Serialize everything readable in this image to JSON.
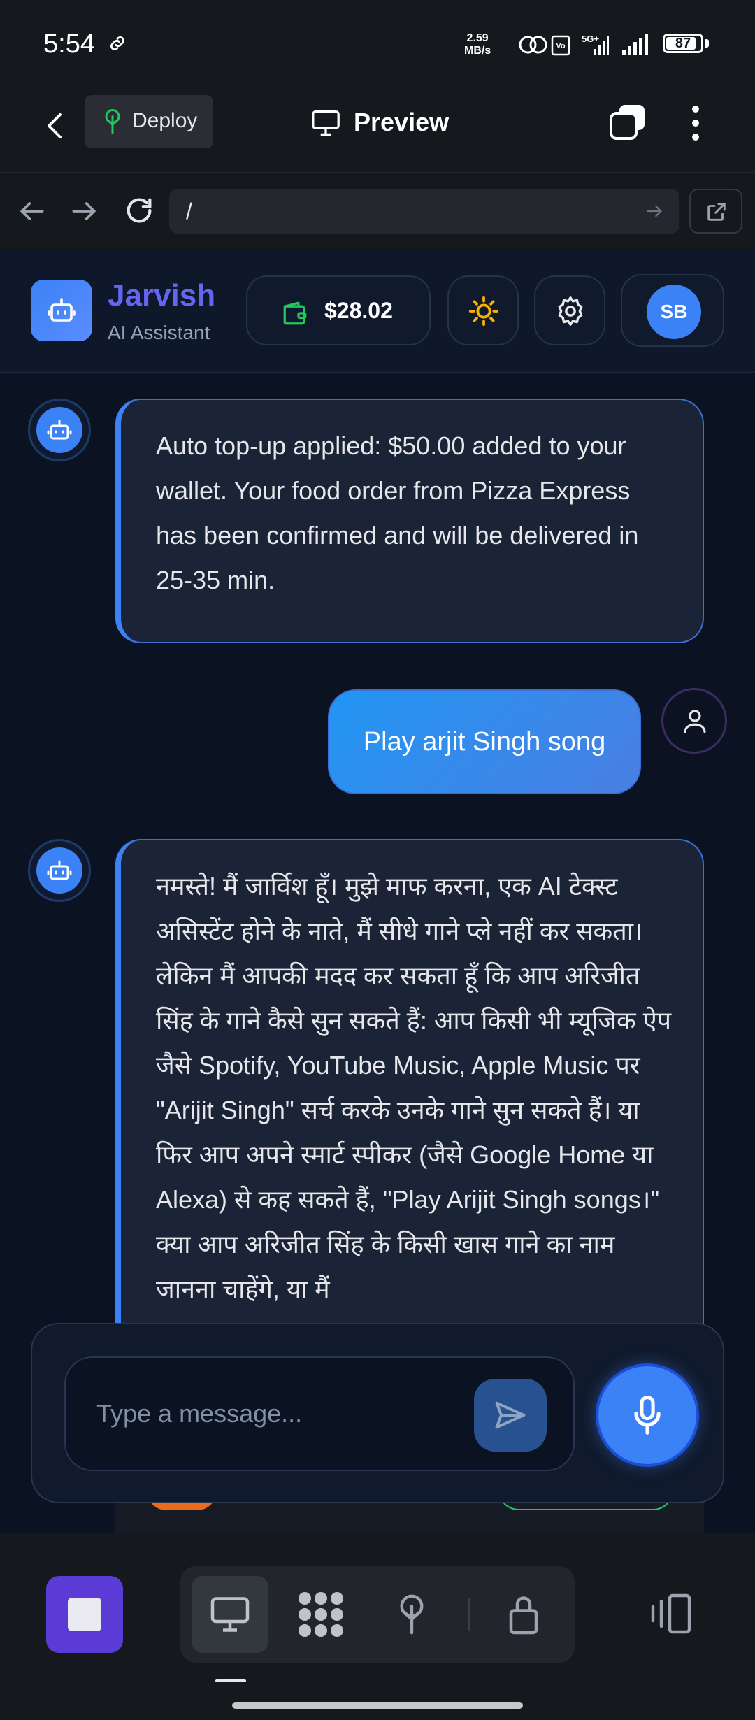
{
  "status_bar": {
    "time": "5:54",
    "net_speed_value": "2.59",
    "net_speed_unit": "MB/s",
    "network": "5G+",
    "battery": "87"
  },
  "header": {
    "deploy_label": "Deploy",
    "title": "Preview"
  },
  "browser": {
    "url": "/"
  },
  "app": {
    "name": "Jarvish",
    "subtitle": "AI Assistant",
    "wallet_balance": "$28.02",
    "avatar_initials": "SB"
  },
  "messages": [
    {
      "role": "assistant",
      "text": "Auto top-up applied: $50.00 added to your wallet. Your food order from Pizza Express has been confirmed and will be delivered in 25-35 min."
    },
    {
      "role": "user",
      "text": "Play arjit Singh song"
    },
    {
      "role": "assistant",
      "text": "नमस्ते! मैं जार्विश हूँ। मुझे माफ करना, एक AI टेक्स्ट असिस्टेंट होने के नाते, मैं सीधे गाने प्ले नहीं कर सकता। लेकिन मैं आपकी मदद कर सकता हूँ कि आप अरिजीत सिंह के गाने कैसे सुन सकते हैं: आप किसी भी म्यूजिक ऐप जैसे Spotify, YouTube Music, Apple Music पर \"Arijit Singh\" सर्च करके उनके गाने सुन सकते हैं। या फिर आप अपने स्मार्ट स्पीकर (जैसे Google Home या Alexa) से कह सकते हैं, \"Play Arijit Singh songs।\" क्या आप अरिजीत सिंह के किसी खास गाने का नाम जानना चाहेंगे, या मैं"
    }
  ],
  "composer": {
    "placeholder": "Type a message..."
  },
  "icons": {
    "back": "back-arrow-icon",
    "deploy": "tree-icon",
    "preview": "monitor-icon",
    "tabs": "tabs-icon",
    "more": "more-vertical-icon",
    "wallet": "wallet-icon",
    "theme": "sun-icon",
    "settings": "gear-icon",
    "bot": "robot-icon",
    "user": "user-icon",
    "send": "send-icon",
    "mic": "microphone-icon"
  },
  "colors": {
    "accent": "#3b82f6",
    "brand_name": "#6366f1",
    "wallet_icon": "#22c55e",
    "sun_icon": "#f5b301",
    "stop_button": "#5b3bd6"
  }
}
